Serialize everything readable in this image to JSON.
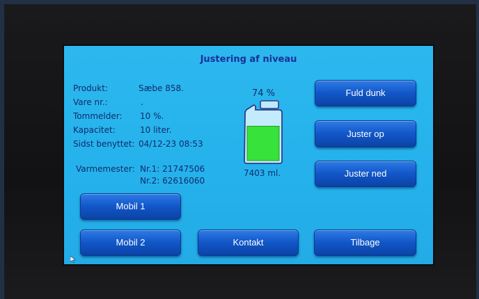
{
  "screen": {
    "title": "Justering af niveau"
  },
  "info": [
    {
      "label": "Produkt:",
      "value": "Sæbe 858."
    },
    {
      "label": "Vare nr.:",
      "value": "."
    },
    {
      "label": "Tommelder:",
      "value": "10 %."
    },
    {
      "label": "Kapacitet:",
      "value": "10 liter."
    },
    {
      "label": "Sidst benyttet:",
      "value": "04/12-23 08:53"
    }
  ],
  "varmemester": {
    "label": "Varmemester:",
    "nr1": "Nr.1: 21747506",
    "nr2": "Nr.2: 62616060"
  },
  "tank": {
    "percent_text": "74 %",
    "volume_text": "7403 ml.",
    "fill_level": 0.74,
    "fill_color": "#37e23a"
  },
  "buttons": {
    "full": "Fuld dunk",
    "up": "Juster op",
    "down": "Juster ned",
    "mobil1": "Mobil 1",
    "mobil2": "Mobil 2",
    "contact": "Kontakt",
    "back": "Tilbage"
  },
  "colors": {
    "screen_bg": "#25b2ec",
    "title": "#1a2f9a",
    "text": "#122a6c",
    "button": "#1257c9"
  }
}
